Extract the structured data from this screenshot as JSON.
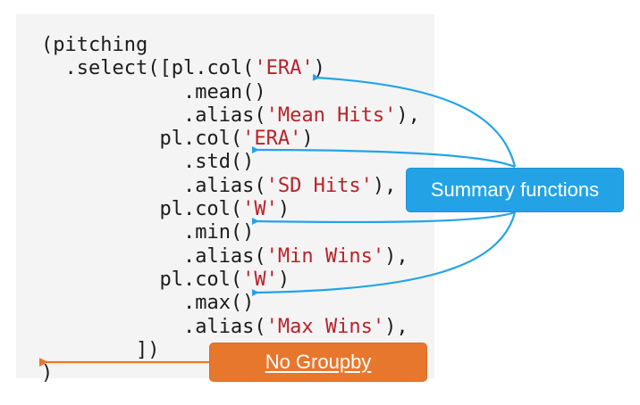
{
  "code_lines": [
    {
      "indent": "(",
      "tokens": [
        {
          "t": "pitching",
          "s": false
        }
      ]
    },
    {
      "indent": "  ",
      "tokens": [
        {
          "t": ".select([pl.col(",
          "s": false
        },
        {
          "t": "'ERA'",
          "s": true
        },
        {
          "t": ")",
          "s": false
        }
      ]
    },
    {
      "indent": "            ",
      "tokens": [
        {
          "t": ".mean()",
          "s": false
        }
      ]
    },
    {
      "indent": "            ",
      "tokens": [
        {
          "t": ".alias(",
          "s": false
        },
        {
          "t": "'Mean Hits'",
          "s": true
        },
        {
          "t": "),",
          "s": false
        }
      ]
    },
    {
      "indent": "          ",
      "tokens": [
        {
          "t": "pl.col(",
          "s": false
        },
        {
          "t": "'ERA'",
          "s": true
        },
        {
          "t": ")",
          "s": false
        }
      ]
    },
    {
      "indent": "            ",
      "tokens": [
        {
          "t": ".std()",
          "s": false
        }
      ]
    },
    {
      "indent": "            ",
      "tokens": [
        {
          "t": ".alias(",
          "s": false
        },
        {
          "t": "'SD Hits'",
          "s": true
        },
        {
          "t": "),",
          "s": false
        }
      ]
    },
    {
      "indent": "          ",
      "tokens": [
        {
          "t": "pl.col(",
          "s": false
        },
        {
          "t": "'W'",
          "s": true
        },
        {
          "t": ")",
          "s": false
        }
      ]
    },
    {
      "indent": "            ",
      "tokens": [
        {
          "t": ".min()",
          "s": false
        }
      ]
    },
    {
      "indent": "            ",
      "tokens": [
        {
          "t": ".alias(",
          "s": false
        },
        {
          "t": "'Min Wins'",
          "s": true
        },
        {
          "t": "),",
          "s": false
        }
      ]
    },
    {
      "indent": "          ",
      "tokens": [
        {
          "t": "pl.col(",
          "s": false
        },
        {
          "t": "'W'",
          "s": true
        },
        {
          "t": ")",
          "s": false
        }
      ]
    },
    {
      "indent": "            ",
      "tokens": [
        {
          "t": ".max()",
          "s": false
        }
      ]
    },
    {
      "indent": "            ",
      "tokens": [
        {
          "t": ".alias(",
          "s": false
        },
        {
          "t": "'Max Wins'",
          "s": true
        },
        {
          "t": "),",
          "s": false
        }
      ]
    },
    {
      "indent": "        ",
      "tokens": [
        {
          "t": "])",
          "s": false
        }
      ]
    },
    {
      "indent": "",
      "tokens": [
        {
          "t": ")",
          "s": false
        }
      ]
    }
  ],
  "callouts": {
    "summary": "Summary functions",
    "groupby": "No Groupby"
  },
  "colors": {
    "code_background": "#f4f4f4",
    "string_literal": "#b8222a",
    "summary_callout": "#23a3e6",
    "groupby_callout": "#e8772e"
  }
}
